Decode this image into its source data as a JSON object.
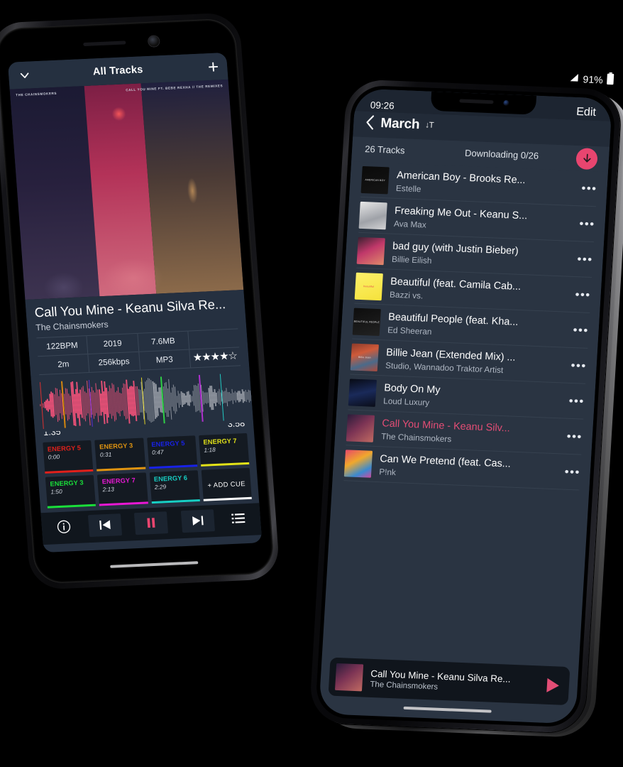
{
  "left_phone": {
    "device": "android-phone",
    "app_bar": {
      "collapse_icon": "chevron-down-icon",
      "title": "All Tracks",
      "add_icon": "plus-icon"
    },
    "artwork": {
      "top_left_caption": "THE CHAINSMOKERS",
      "top_right_caption": "CALL YOU MINE FT. BEBE REXHA // THE REMIXES"
    },
    "now_playing": {
      "title": "Call You Mine - Keanu Silva Re...",
      "artist": "The Chainsmokers"
    },
    "details": {
      "row1": [
        "122BPM",
        "2019",
        "7.6MB",
        ""
      ],
      "row2": [
        "2m",
        "256kbps",
        "MP3",
        ""
      ],
      "rating": "★★★★☆",
      "rating_value": 4,
      "rating_max": 5
    },
    "waveform": {
      "elapsed": "1:35",
      "duration": "3:58",
      "played_color": "#e24f75",
      "remaining_color": "#8b919b",
      "marker_colors": [
        "#d93030",
        "#d4860e",
        "#5a2fd6",
        "#e0d22a",
        "#2fcf46",
        "#b030cf",
        "#21c9c2"
      ]
    },
    "cues": [
      {
        "label": "ENERGY 5",
        "time": "0:00",
        "color": "#e2201b"
      },
      {
        "label": "ENERGY 3",
        "time": "0:31",
        "color": "#e09410"
      },
      {
        "label": "ENERGY 5",
        "time": "0:47",
        "color": "#1822e8"
      },
      {
        "label": "ENERGY 7",
        "time": "1:18",
        "color": "#e2e218"
      },
      {
        "label": "ENERGY 3",
        "time": "1:50",
        "color": "#1ae03a"
      },
      {
        "label": "ENERGY 7",
        "time": "2:13",
        "color": "#e818d4"
      },
      {
        "label": "ENERGY 6",
        "time": "2:29",
        "color": "#17cfc4"
      },
      {
        "label": "+  ADD CUE",
        "time": "",
        "color": "#ffffff",
        "is_add": true
      }
    ],
    "transport": [
      {
        "name": "info-icon",
        "glyph": "i"
      },
      {
        "name": "previous-track-icon",
        "glyph": "prev"
      },
      {
        "name": "pause-icon",
        "glyph": "pause"
      },
      {
        "name": "next-track-icon",
        "glyph": "next"
      },
      {
        "name": "queue-list-icon",
        "glyph": "list"
      }
    ]
  },
  "right_phone": {
    "device": "iphone-x",
    "status_bar": {
      "signal_icon": "signal-icon",
      "battery_percent": "91%",
      "battery_icon": "battery-icon",
      "clock": "09:26",
      "edit_label": "Edit"
    },
    "nav": {
      "back_icon": "chevron-left-icon",
      "title": "March",
      "sort_icon": "sort-descending-icon",
      "sort_glyph": "↓T"
    },
    "sub_header": {
      "track_count": "26 Tracks",
      "download_status": "Downloading 0/26",
      "download_icon": "download-arrow-icon",
      "download_button_color": "#e8456f"
    },
    "tracks": [
      {
        "title": "American Boy - Brooks Re...",
        "artist": "Estelle",
        "cover": "black",
        "cover_text": "AMERICAN BOY",
        "active": false
      },
      {
        "title": "Freaking Me Out - Keanu S...",
        "artist": "Ava Max",
        "cover": "grey",
        "cover_text": "",
        "active": false
      },
      {
        "title": "bad guy (with Justin Bieber)",
        "artist": "Billie Eilish",
        "cover": "pink",
        "cover_text": "",
        "active": false
      },
      {
        "title": "Beautiful (feat. Camila Cab...",
        "artist": "Bazzi vs.",
        "cover": "yellow",
        "cover_text": "beautiful",
        "active": false
      },
      {
        "title": "Beautiful People (feat. Kha...",
        "artist": "Ed Sheeran",
        "cover": "dark",
        "cover_text": "BEAUTIFUL PEOPLE",
        "active": false
      },
      {
        "title": "Billie Jean (Extended Mix) ...",
        "artist": "Studio, Wannadoo Traktor Artist",
        "cover": "collage",
        "cover_text": "Billie Jean",
        "active": false
      },
      {
        "title": "Body On My",
        "artist": "Loud Luxury",
        "cover": "navy",
        "cover_text": "",
        "active": false
      },
      {
        "title": "Call You Mine - Keanu Silv...",
        "artist": "The Chainsmokers",
        "cover": "street",
        "cover_text": "",
        "active": true
      },
      {
        "title": "Can We Pretend (feat. Cas...",
        "artist": "P!nk",
        "cover": "colorful",
        "cover_text": "",
        "active": false
      }
    ],
    "now_playing_bar": {
      "title": "Call You Mine - Keanu Silva Re...",
      "artist": "The Chainsmokers",
      "play_icon": "play-icon",
      "accent_color": "#e34d75"
    },
    "menu_icon": "more-options-icon"
  }
}
